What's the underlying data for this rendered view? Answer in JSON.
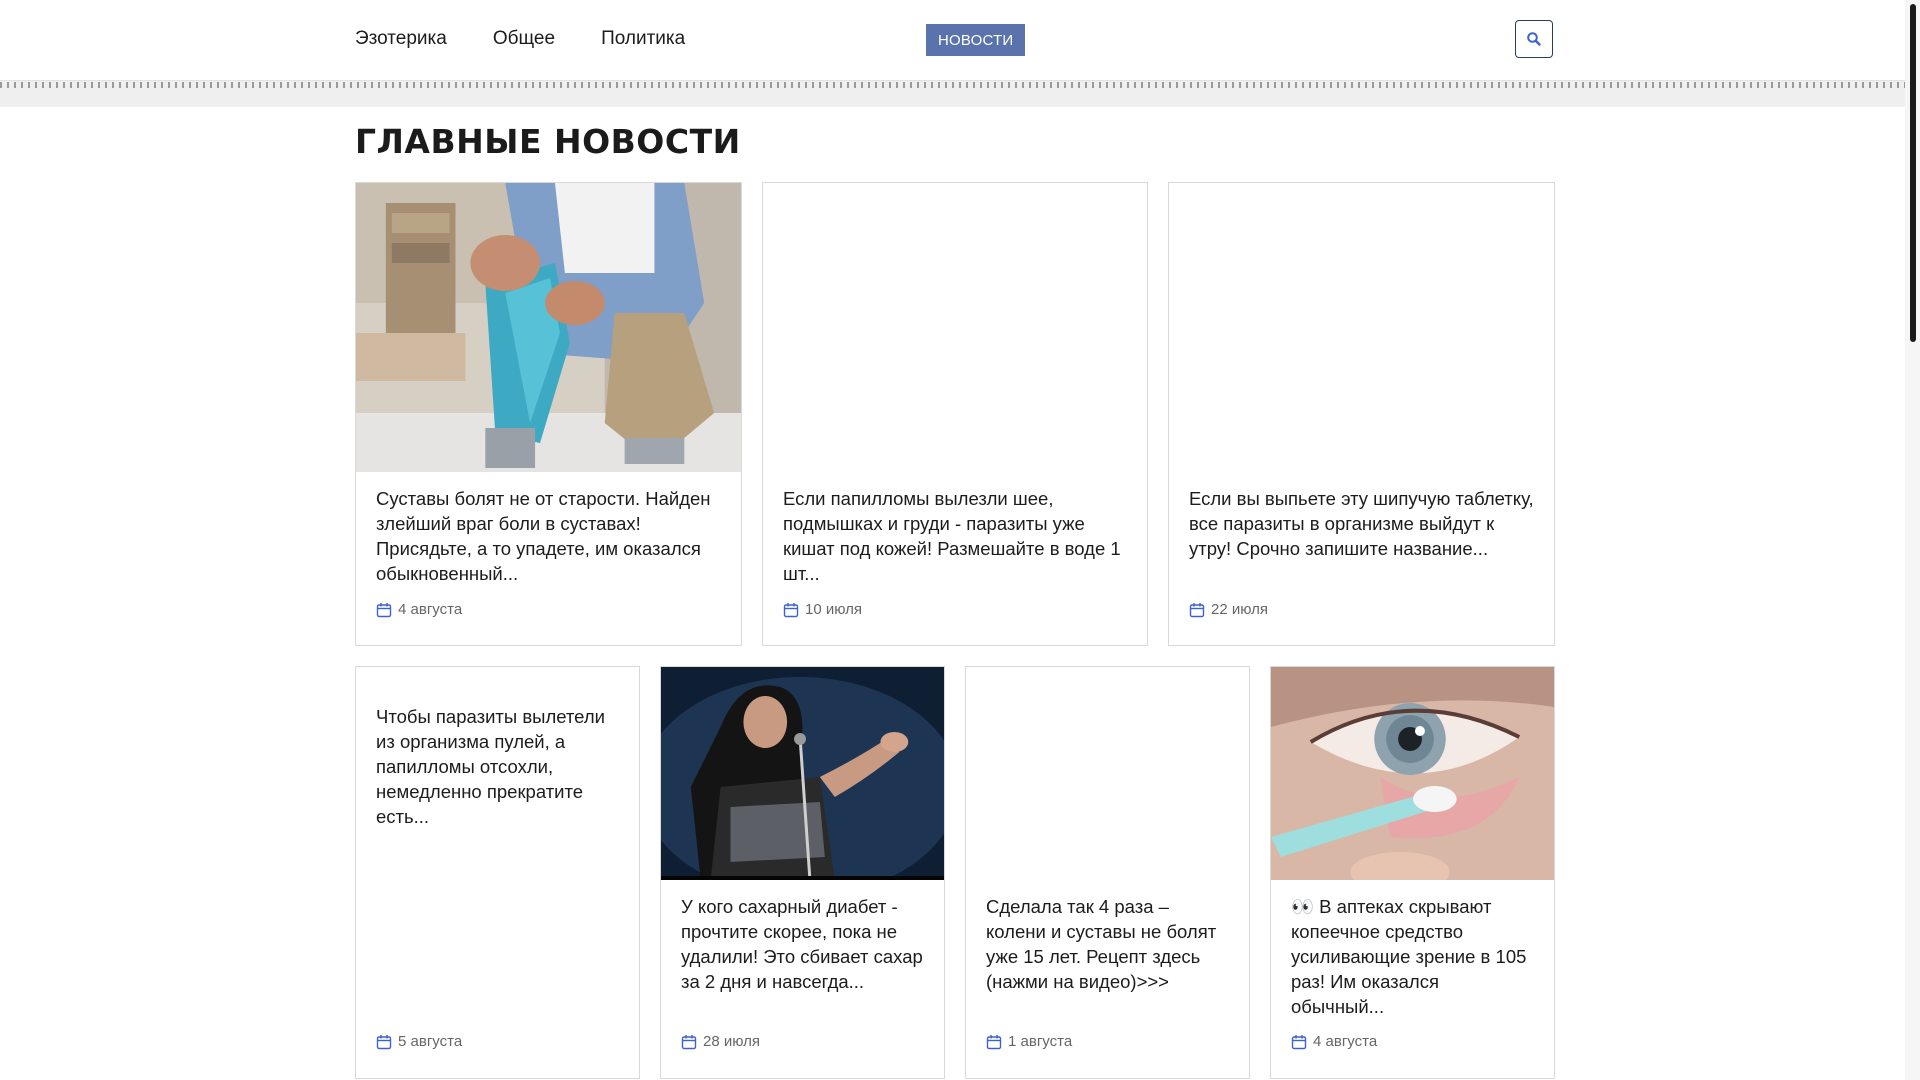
{
  "nav": {
    "items": [
      {
        "label": "Эзотерика"
      },
      {
        "label": "Общее"
      },
      {
        "label": "Политика"
      }
    ],
    "badge": "НОВОСТИ"
  },
  "section": {
    "title": "ГЛАВНЫЕ НОВОСТИ"
  },
  "cards": [
    {
      "title": "Суставы болят не от старости. Найден злейший враг боли в суставах! Присядьте, а то упадете, им оказался обыкновенный...",
      "date": "4 августа",
      "image": "knee-tape-photo"
    },
    {
      "title": "Если папилломы вылезли шее, подмышках и груди - паразиты уже кишат под кожей! Размешайте в воде 1 шт...",
      "date": "10 июля",
      "image": ""
    },
    {
      "title": "Если вы выпьете эту шипучую таблетку, все паразиты в организме выйдут к утру! Срочно запишите название...",
      "date": "22 июля",
      "image": ""
    },
    {
      "title": "Чтобы паразиты вылетели из организма пулей, а папилломы отсохли, немедленно прекратите есть...",
      "date": "5 августа",
      "image": ""
    },
    {
      "title": "У кого сахарный диабет - прочтите скорее, пока не удалили! Это сбивает сахар за 2 дня и навсегда...",
      "date": "28 июля",
      "image": "singer-photo"
    },
    {
      "title": "Сделала так 4 раза – колени и суставы не болят уже 15 лет. Рецепт здесь (нажми на видео)>>>",
      "date": "1 августа",
      "image": ""
    },
    {
      "title": "👀 В аптеках скрывают копеечное средство усиливающие зрение в 105 раз! Им оказался обычный...",
      "date": "4 августа",
      "image": "eye-swab-photo"
    }
  ],
  "colors": {
    "accent": "#5a73ad",
    "icon": "#3b63c9"
  }
}
